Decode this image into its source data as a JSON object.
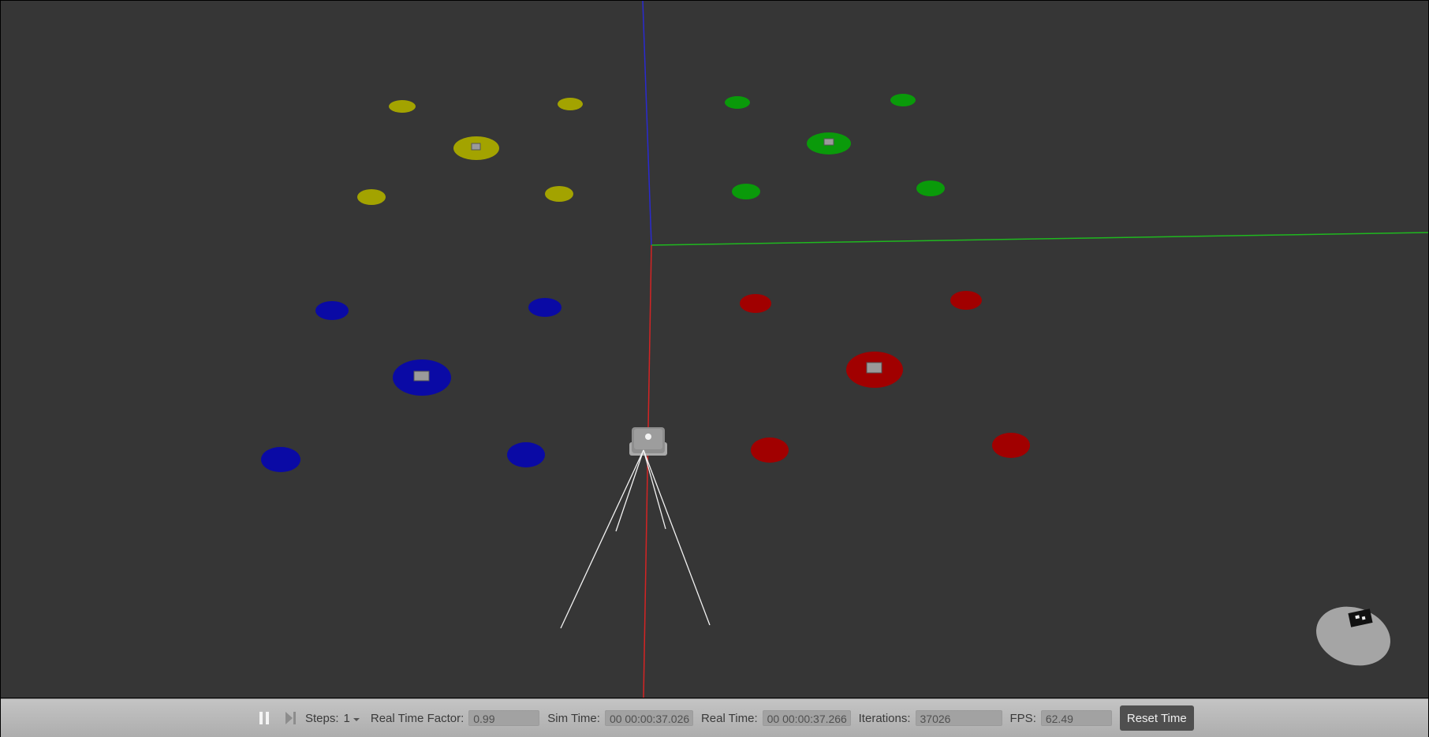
{
  "scene": {
    "axis_colors": {
      "x": "#d42424",
      "y": "#1fb81f",
      "z": "#2a2ad0"
    },
    "zone_colors": {
      "yellow": "#a3a300",
      "green": "#0a9a0a",
      "blue": "#0a0aa5",
      "red": "#a10000"
    },
    "ground_color": "#363636",
    "marker_color": "#9a9a9a"
  },
  "toolbar": {
    "pause_icon": "pause-icon",
    "step_icon": "step-forward-icon",
    "steps_label": "Steps:",
    "steps_value": "1",
    "rtf_label": "Real Time Factor:",
    "rtf_value": "0.99",
    "sim_time_label": "Sim Time:",
    "sim_time_value": "00 00:00:37.026",
    "real_time_label": "Real Time:",
    "real_time_value": "00 00:00:37.266",
    "iterations_label": "Iterations:",
    "iterations_value": "37026",
    "fps_label": "FPS:",
    "fps_value": "62.49",
    "reset_label": "Reset Time"
  }
}
